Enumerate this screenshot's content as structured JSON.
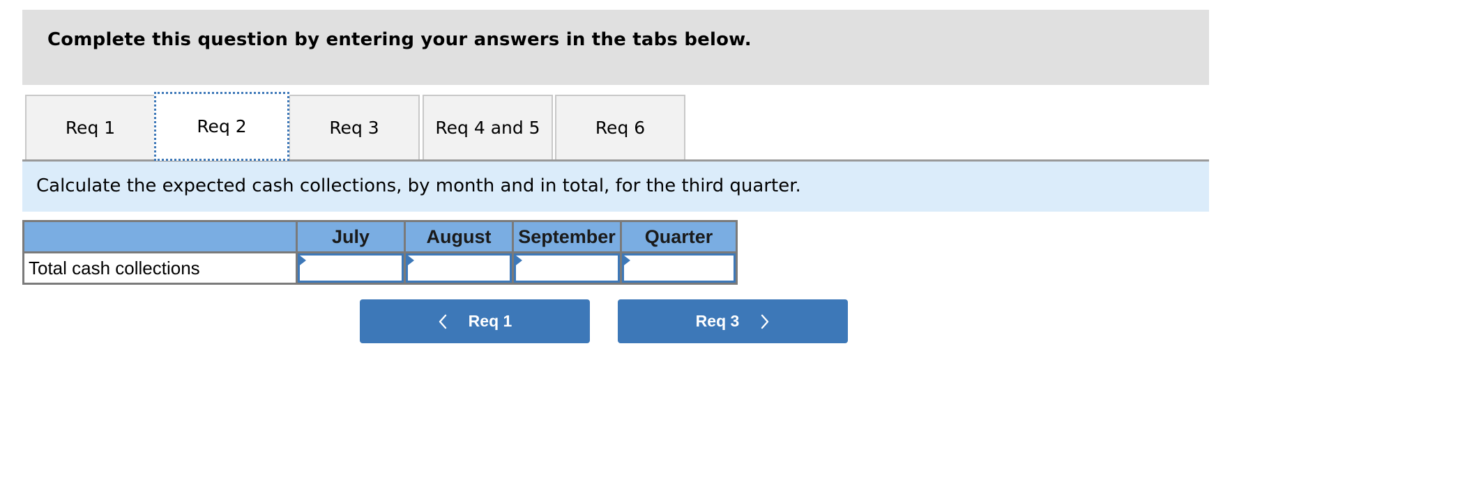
{
  "header": {
    "instruction": "Complete this question by entering your answers in the tabs below."
  },
  "tabs": [
    {
      "label": "Req 1",
      "active": false
    },
    {
      "label": "Req 2",
      "active": true
    },
    {
      "label": "Req 3",
      "active": false
    },
    {
      "label": "Req 4 and 5",
      "active": false
    },
    {
      "label": "Req 6",
      "active": false
    }
  ],
  "question": {
    "text": "Calculate the expected cash collections, by month and in total, for the third quarter."
  },
  "table": {
    "columns": [
      "",
      "July",
      "August",
      "September",
      "Quarter"
    ],
    "rows": [
      {
        "label": "Total cash collections",
        "values": [
          "",
          "",
          "",
          ""
        ]
      }
    ]
  },
  "navigation": {
    "prev_label": "Req 1",
    "prev_icon": "chevron-left-icon",
    "next_label": "Req 3",
    "next_icon": "chevron-right-icon"
  },
  "colors": {
    "accent": "#3d78b8",
    "header_bg": "#e0e0e0",
    "band_bg": "#dbecfa",
    "table_header_bg": "#7aade2"
  }
}
